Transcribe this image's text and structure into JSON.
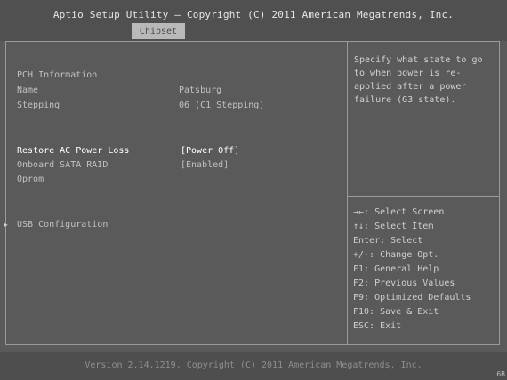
{
  "header": {
    "title": "Aptio Setup Utility – Copyright (C) 2011 American Megatrends, Inc.",
    "tabs": [
      {
        "label": "Chipset",
        "active": true
      }
    ]
  },
  "main": {
    "section_title": "PCH Information",
    "info": [
      {
        "label": "Name",
        "value": "Patsburg"
      },
      {
        "label": "Stepping",
        "value": "06 (C1 Stepping)"
      }
    ],
    "settings": [
      {
        "label": "Restore AC Power Loss",
        "value": "[Power Off]",
        "selected": true
      },
      {
        "label": "Onboard SATA RAID",
        "label2": "Oprom",
        "value": "[Enabled]",
        "selected": false
      }
    ],
    "submenu": {
      "label": "USB Configuration",
      "icon": "triangle-right-icon"
    }
  },
  "help": {
    "text": "Specify what state to go to when power is re-applied after a power failure (G3 state)."
  },
  "keys": [
    "→←: Select Screen",
    "↑↓: Select Item",
    "Enter: Select",
    "+/-: Change Opt.",
    "F1: General Help",
    "F2: Previous Values",
    "F9: Optimized Defaults",
    "F10: Save & Exit",
    "ESC: Exit"
  ],
  "footer": {
    "version": "Version 2.14.1219. Copyright (C) 2011 American Megatrends, Inc.",
    "corner_code": "6B"
  }
}
